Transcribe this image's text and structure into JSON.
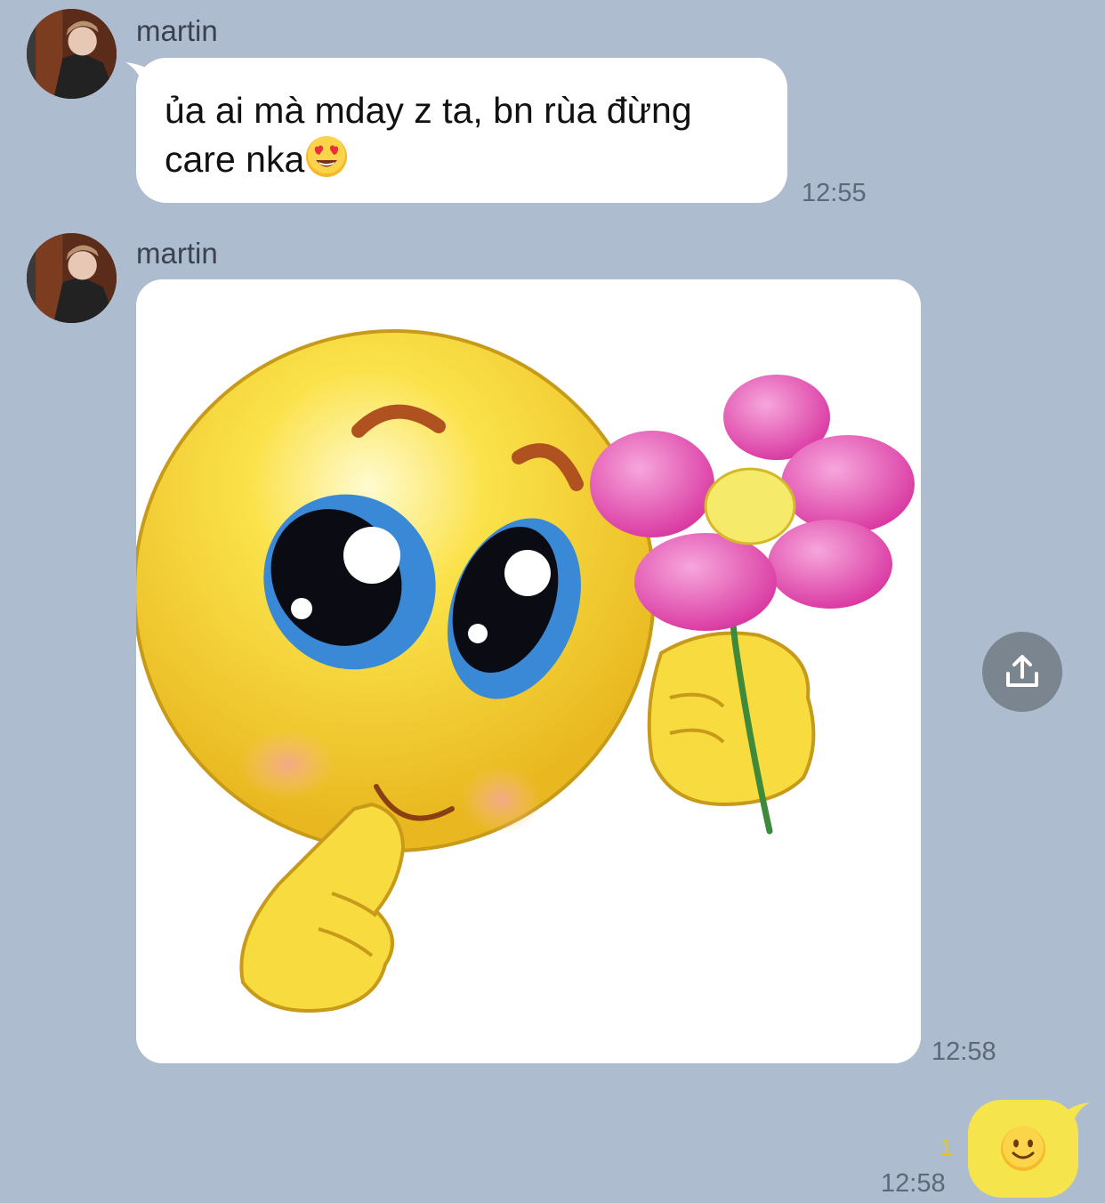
{
  "colors": {
    "background": "#adbccf",
    "incoming_bubble": "#ffffff",
    "outgoing_bubble": "#f5e44b",
    "share_button": "#7b8590",
    "read_count": "#e3c81c"
  },
  "messages": [
    {
      "sender": "martin",
      "text": "ủa ai mà mday z ta, bn rùa đừng care nka",
      "emoji": "smiling-face-with-heart-eyes",
      "time": "12:55"
    },
    {
      "sender": "martin",
      "image": "smiley-holding-pink-flower",
      "time": "12:58"
    }
  ],
  "outgoing": {
    "emoji": "slightly-smiling-face",
    "read_count": "1",
    "time": "12:58"
  },
  "share_button": {
    "icon": "upload-share-icon"
  }
}
